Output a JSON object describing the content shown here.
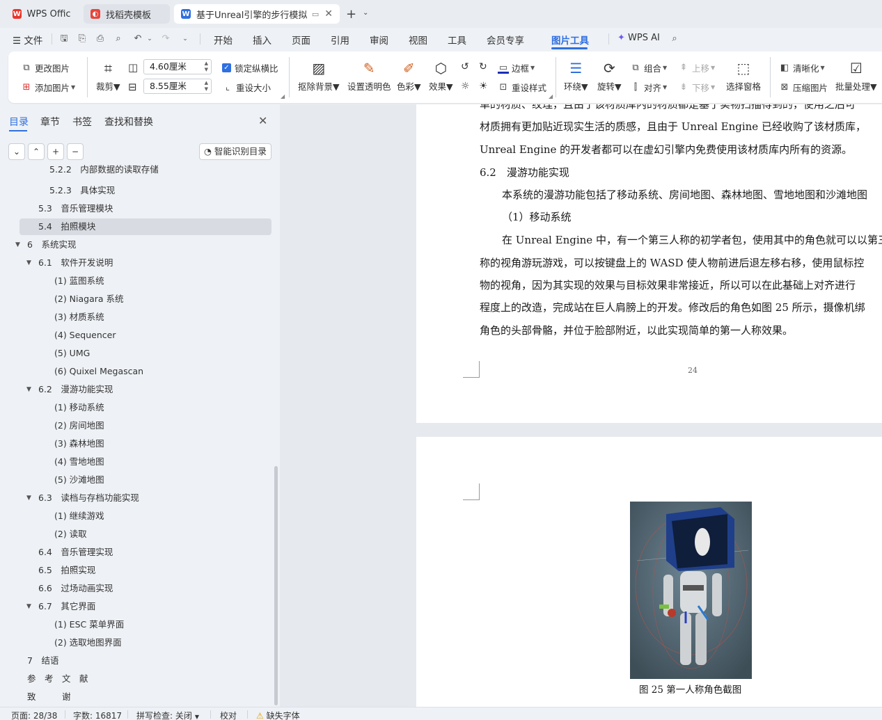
{
  "tabs": [
    {
      "label": "WPS Office",
      "icon": "wps-logo-icon"
    },
    {
      "label": "找稻壳模板",
      "icon": "docer-logo-icon"
    },
    {
      "label": "基于Unreal引擎的步行模拟器",
      "icon": "wps-writer-icon"
    }
  ],
  "menu": {
    "file": "文件",
    "items": [
      "开始",
      "插入",
      "页面",
      "引用",
      "审阅",
      "视图",
      "工具",
      "会员专享",
      "图片工具"
    ],
    "active": "图片工具",
    "ai": "WPS AI"
  },
  "ribbon": {
    "change_image": "更改图片",
    "add_image": "添加图片",
    "crop": "裁剪",
    "width_value": "4.60厘米",
    "height_value": "8.55厘米",
    "lock_ratio": "锁定纵横比",
    "reset_size": "重设大小",
    "remove_bg": "抠除背景",
    "set_transparent": "设置透明色",
    "color": "色彩",
    "effects": "效果",
    "border": "边框",
    "reset_style": "重设样式",
    "wrap": "环绕",
    "rotate": "旋转",
    "group": "组合",
    "align": "对齐",
    "move_up": "上移",
    "move_down": "下移",
    "selection_pane": "选择窗格",
    "sharpen": "清晰化",
    "compress": "压缩图片",
    "batch": "批量处理"
  },
  "nav": {
    "tabs": [
      "目录",
      "章节",
      "书签",
      "查找和替换"
    ],
    "ai_button": "智能识别目录",
    "toc": [
      {
        "text": "5.2.2　内部数据的读取存储",
        "level": 3
      },
      {
        "text": "5.2.3　具体实现",
        "level": 3
      },
      {
        "text": "5.3　音乐管理模块",
        "level": 2
      },
      {
        "text": "5.4　拍照模块",
        "level": 2,
        "selected": true
      },
      {
        "text": "6　系统实现",
        "level": 1,
        "expanded": true
      },
      {
        "text": "6.1　软件开发说明",
        "level": 2,
        "expanded": true
      },
      {
        "text": "(1)  蓝图系统",
        "level": 3
      },
      {
        "text": "(2)  Niagara 系统",
        "level": 3
      },
      {
        "text": "(3)  材质系统",
        "level": 3
      },
      {
        "text": "(4)  Sequencer",
        "level": 3
      },
      {
        "text": "(5)  UMG",
        "level": 3
      },
      {
        "text": "(6)  Quixel Megascan",
        "level": 3
      },
      {
        "text": "6.2　漫游功能实现",
        "level": 2,
        "expanded": true
      },
      {
        "text": "(1)  移动系统",
        "level": 3
      },
      {
        "text": "(2)  房间地图",
        "level": 3
      },
      {
        "text": "(3)  森林地图",
        "level": 3
      },
      {
        "text": "(4)  雪地地图",
        "level": 3
      },
      {
        "text": "(5)  沙滩地图",
        "level": 3
      },
      {
        "text": "6.3　读档与存档功能实现",
        "level": 2,
        "expanded": true
      },
      {
        "text": "(1)  继续游戏",
        "level": 3
      },
      {
        "text": "(2)  读取",
        "level": 3
      },
      {
        "text": "6.4　音乐管理实现",
        "level": 2
      },
      {
        "text": "6.5　拍照实现",
        "level": 2
      },
      {
        "text": "6.6　过场动画实现",
        "level": 2
      },
      {
        "text": "6.7　其它界面",
        "level": 2,
        "expanded": true
      },
      {
        "text": "(1)  ESC 菜单界面",
        "level": 3
      },
      {
        "text": "(2)  选取地图界面",
        "level": 3
      },
      {
        "text": "7　结语",
        "level": 1
      },
      {
        "text": "参　考　文　献",
        "level": 1
      },
      {
        "text": "致　　　谢",
        "level": 1
      }
    ]
  },
  "document": {
    "page1_lines": [
      "单的材质、纹理，且由于该材质库内的材质都是基于实物扫描得到的，使用之后可",
      "材质拥有更加贴近现实生活的质感，且由于 Unreal Engine 已经收购了该材质库，",
      "Unreal Engine 的开发者都可以在虚幻引擎内免费使用该材质库内所有的资源。",
      "6.2　漫游功能实现",
      "本系统的漫游功能包括了移动系统、房间地图、森林地图、雪地地图和沙滩地图",
      "（1）移动系统",
      "在 Unreal Engine 中，有一个第三人称的初学者包，使用其中的角色就可以以第三",
      "称的视角游玩游戏，可以按键盘上的 WASD 使人物前进后退左移右移，使用鼠标控",
      "物的视角，因为其实现的效果与目标效果非常接近，所以可以在此基础上对齐进行",
      "程度上的改造，完成站在巨人肩膀上的开发。修改后的角色如图 25 所示，摄像机绑",
      "角色的头部骨骼，并位于脸部附近，以此实现简单的第一人称效果。"
    ],
    "page_number": "24",
    "figure_caption": "图 25  第一人称角色截图"
  },
  "status": {
    "page": "页面: 28/38",
    "words": "字数: 16817",
    "spell": "拼写检查: 关闭",
    "proof": "校对",
    "missing_font": "缺失字体"
  },
  "colors": {
    "accent": "#2f6fe0",
    "wps_red": "#e8362c"
  }
}
